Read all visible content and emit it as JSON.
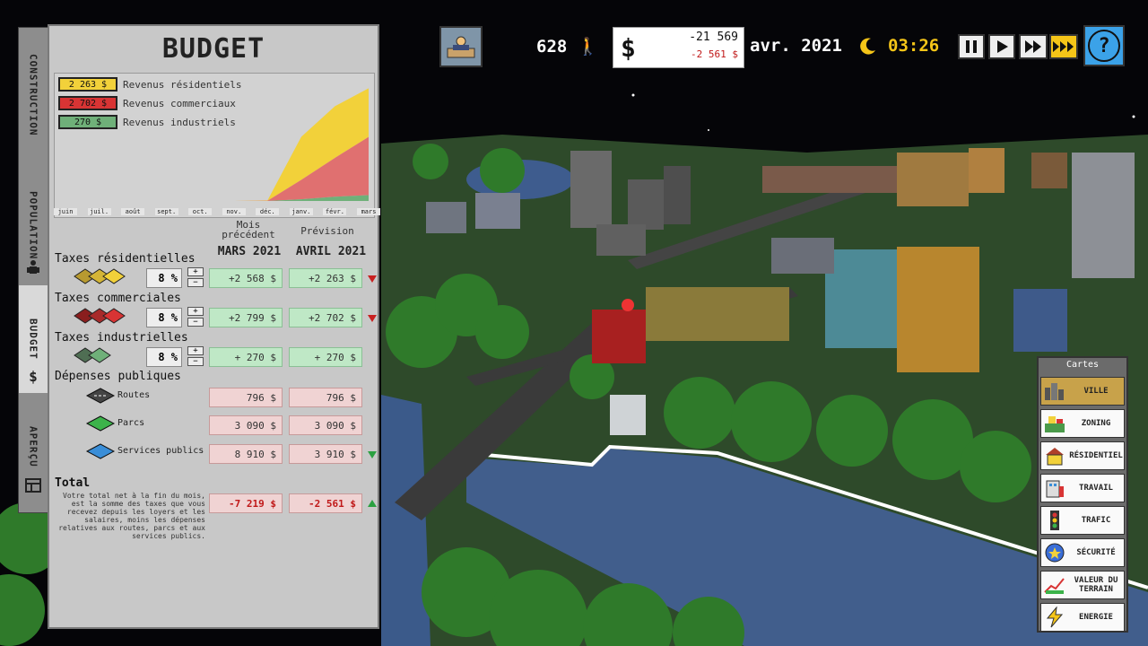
{
  "side_tabs": {
    "construction": "CONSTRUCTION",
    "population": "POPULATION",
    "budget": "BUDGET",
    "apercu": "APERÇU"
  },
  "budget": {
    "title": "BUDGET",
    "legend": [
      {
        "value": "2 263 $",
        "label": "Revenus résidentiels",
        "color": "#f2d13a"
      },
      {
        "value": "2 702 $",
        "label": "Revenus commerciaux",
        "color": "#d83434"
      },
      {
        "value": "270 $",
        "label": "Revenus industriels",
        "color": "#6fb079"
      }
    ],
    "months": [
      "juin",
      "juil.",
      "août",
      "sept.",
      "oct.",
      "nov.",
      "déc.",
      "janv.",
      "févr.",
      "mars"
    ],
    "col_prev_top": "Mois précédent",
    "col_prev_month": "MARS 2021",
    "col_next_top": "Prévision",
    "col_next_month": "AVRIL 2021",
    "taxes": [
      {
        "label": "Taxes résidentielles",
        "pct": "8 %",
        "prev": "+2 568 $",
        "next": "+2 263 $",
        "trend": "down"
      },
      {
        "label": "Taxes commerciales",
        "pct": "8 %",
        "prev": "+2 799 $",
        "next": "+2 702 $",
        "trend": "down"
      },
      {
        "label": "Taxes industrielles",
        "pct": "8 %",
        "prev": "+ 270 $",
        "next": "+ 270 $",
        "trend": "none"
      }
    ],
    "depenses_label": "Dépenses publiques",
    "depenses": [
      {
        "label": "Routes",
        "prev": "796 $",
        "next": "796 $",
        "trend": "none"
      },
      {
        "label": "Parcs",
        "prev": "3 090 $",
        "next": "3 090 $",
        "trend": "none"
      },
      {
        "label": "Services publics",
        "prev": "8 910 $",
        "next": "3 910 $",
        "trend": "down-green"
      }
    ],
    "total_label": "Total",
    "total_desc": "Votre total net à la fin du mois, est la somme des taxes que vous recevez depuis les loyers et les salaires, moins les dépenses relatives aux routes, parcs et aux services publics.",
    "total_prev": "-7 219 $",
    "total_next": "-2 561 $",
    "chart_data": {
      "type": "area",
      "categories": [
        "juin",
        "juil.",
        "août",
        "sept.",
        "oct.",
        "nov.",
        "déc.",
        "janv.",
        "févr.",
        "mars"
      ],
      "series": [
        {
          "name": "Revenus industriels",
          "values": [
            0,
            0,
            0,
            0,
            0,
            0,
            0,
            80,
            200,
            270
          ]
        },
        {
          "name": "Revenus commerciaux",
          "values": [
            0,
            0,
            0,
            0,
            0,
            0,
            10,
            900,
            1800,
            2702
          ]
        },
        {
          "name": "Revenus résidentiels",
          "values": [
            0,
            0,
            0,
            0,
            0,
            0,
            20,
            2000,
            2400,
            2263
          ]
        }
      ]
    }
  },
  "topbar": {
    "population": "628",
    "money": "-21 569",
    "money_delta": "-2 561 $",
    "date": "avr. 2021",
    "time": "03:26",
    "help": "?"
  },
  "maps": {
    "title": "Cartes",
    "items": [
      "VILLE",
      "ZONING",
      "RÉSIDENTIEL",
      "TRAVAIL",
      "TRAFIC",
      "SÉCURITÉ",
      "VALEUR DU TERRAIN",
      "ENERGIE"
    ]
  }
}
